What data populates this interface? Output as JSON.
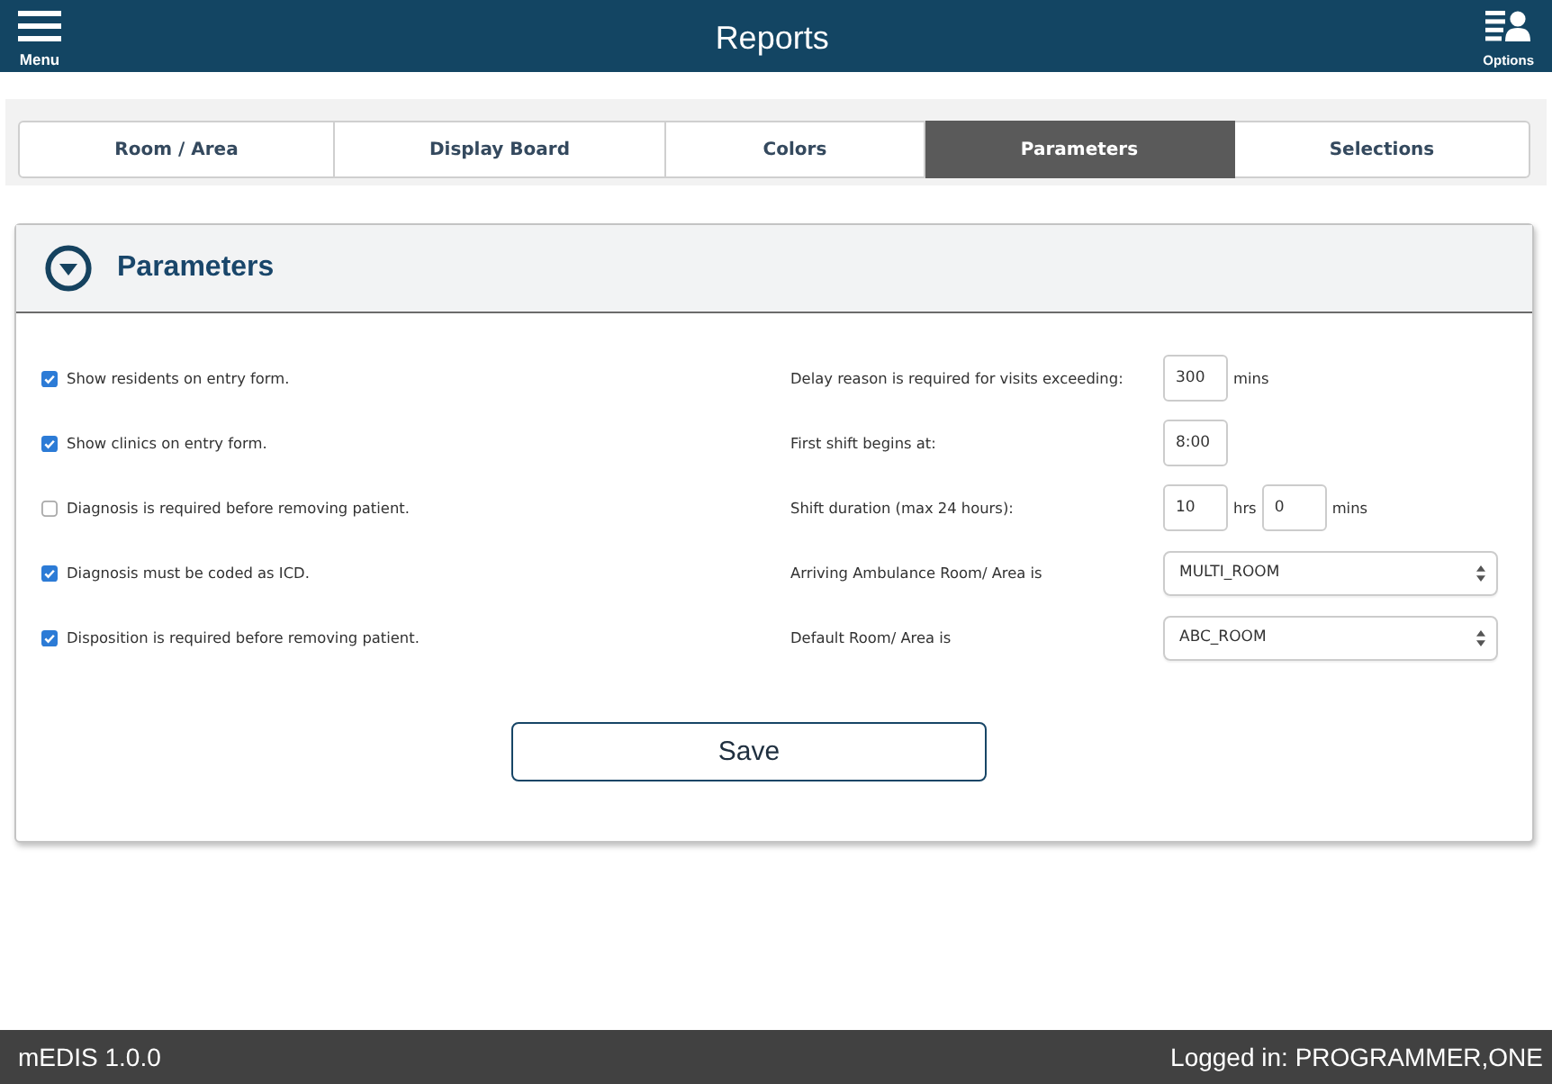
{
  "header": {
    "menu_label": "Menu",
    "title": "Reports",
    "options_label": "Options"
  },
  "tabs": [
    {
      "label": "Room / Area",
      "selected": false
    },
    {
      "label": "Display Board",
      "selected": false
    },
    {
      "label": "Colors",
      "selected": false
    },
    {
      "label": "Parameters",
      "selected": true
    },
    {
      "label": "Selections",
      "selected": false
    }
  ],
  "panel": {
    "title": "Parameters",
    "expanded": true
  },
  "options": [
    {
      "label": "Show residents on entry form.",
      "checked": true
    },
    {
      "label": "Show clinics on entry form.",
      "checked": true
    },
    {
      "label": "Diagnosis is required before removing patient.",
      "checked": false
    },
    {
      "label": "Diagnosis must be coded as ICD.",
      "checked": true
    },
    {
      "label": "Disposition is required before removing patient.",
      "checked": true
    }
  ],
  "settings": [
    {
      "kind": "input",
      "label": "Delay reason is required for visits exceeding:",
      "fields": [
        {
          "value": "300",
          "unit": "mins"
        }
      ]
    },
    {
      "kind": "input",
      "label": "First shift begins at:",
      "fields": [
        {
          "value": "8:00"
        }
      ]
    },
    {
      "kind": "input",
      "label": "Shift duration (max 24 hours):",
      "fields": [
        {
          "value": "10",
          "unit": "hrs"
        },
        {
          "value": "0",
          "unit": "mins"
        }
      ]
    },
    {
      "kind": "select",
      "label": "Arriving Ambulance Room/ Area is",
      "value": "MULTI_ROOM"
    },
    {
      "kind": "select",
      "label": "Default Room/ Area is",
      "value": "ABC_ROOM"
    }
  ],
  "save_button": "Save",
  "status_bar": {
    "app_version": "mEDIS 1.0.0",
    "user": "Logged in: PROGRAMMER,ONE"
  }
}
